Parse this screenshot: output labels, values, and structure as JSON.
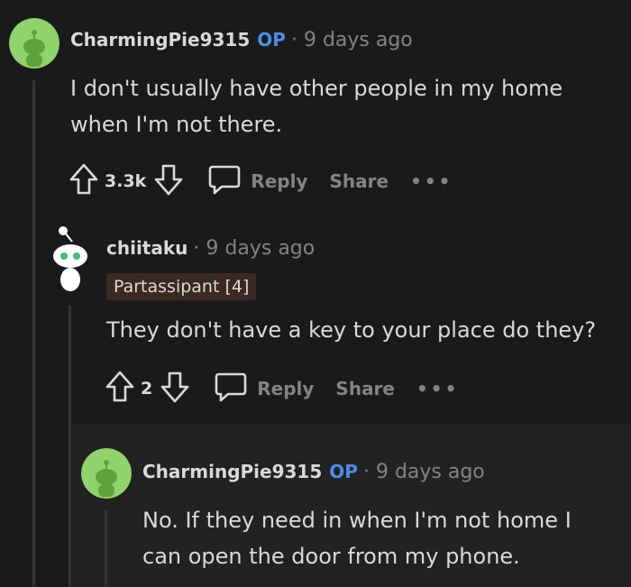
{
  "comments": [
    {
      "username": "CharmingPie9315",
      "op_badge": "OP",
      "time": "9 days ago",
      "body_lines": [
        "I don't usually have other people in my home",
        "when I'm not there."
      ],
      "score": "3.3k",
      "reply_label": "Reply",
      "share_label": "Share",
      "more_label": "•••"
    },
    {
      "username": "chiitaku",
      "time": "9 days ago",
      "flair": "Partassipant [4]",
      "body_lines": [
        "They don't have a key to your place do they?"
      ],
      "score": "2",
      "reply_label": "Reply",
      "share_label": "Share",
      "more_label": "•••"
    },
    {
      "username": "CharmingPie9315",
      "op_badge": "OP",
      "time": "9 days ago",
      "body_lines": [
        "No. If they need in when I'm not home I",
        "can open the door from my phone."
      ]
    }
  ],
  "colors": {
    "background": "#1a1a1b",
    "op": "#4d8de8",
    "muted": "#818384",
    "avatar_green": "#8fd36a",
    "flair_bg": "#3a2a22"
  },
  "icons": [
    "upvote-icon",
    "downvote-icon",
    "comment-icon",
    "more-icon"
  ]
}
